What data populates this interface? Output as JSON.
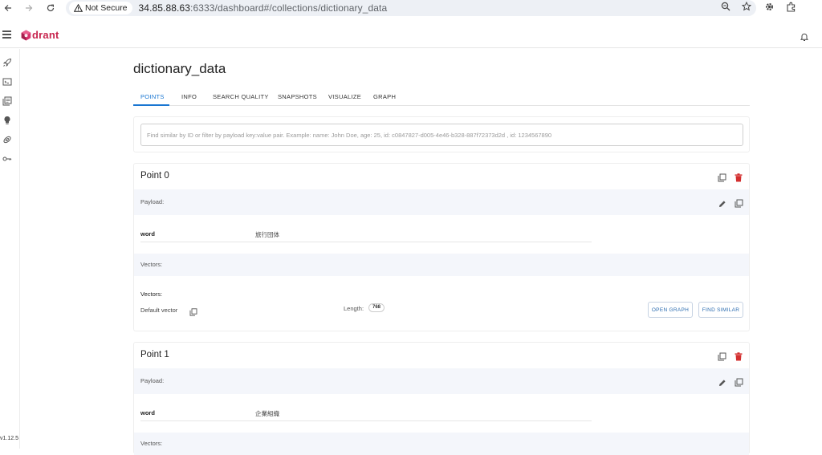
{
  "browser": {
    "security_label": "Not Secure",
    "url_host": "34.85.88.63",
    "url_rest": ":6333/dashboard#/collections/dictionary_data"
  },
  "app": {
    "version": "v1.12.5"
  },
  "page": {
    "title": "dictionary_data"
  },
  "tabs": [
    {
      "label": "POINTS",
      "active": true
    },
    {
      "label": "INFO"
    },
    {
      "label": "SEARCH QUALITY"
    },
    {
      "label": "SNAPSHOTS"
    },
    {
      "label": "VISUALIZE"
    },
    {
      "label": "GRAPH"
    }
  ],
  "search": {
    "placeholder": "Find similar by ID or filter by payload key:value pair. Example: name: John Doe, age: 25, id: c0847827-d005-4e46-b328-887f72373d2d , id: 1234567890"
  },
  "points": [
    {
      "title": "Point 0",
      "payload_label": "Payload:",
      "payload": {
        "key": "word",
        "value": "旅行団体"
      },
      "vectors_band_label": "Vectors:",
      "vectors_heading": "Vectors:",
      "vector_name": "Default vector",
      "length_label": "Length:",
      "length_value": "768",
      "open_graph_label": "OPEN GRAPH",
      "find_similar_label": "FIND SIMILAR"
    },
    {
      "title": "Point 1",
      "payload_label": "Payload:",
      "payload": {
        "key": "word",
        "value": "企業組織"
      },
      "vectors_band_label": "Vectors:"
    }
  ],
  "colors": {
    "accent": "#1976d2",
    "delete": "#d32f2f",
    "brand": "#c7254e",
    "band": "#f4f6fb"
  }
}
